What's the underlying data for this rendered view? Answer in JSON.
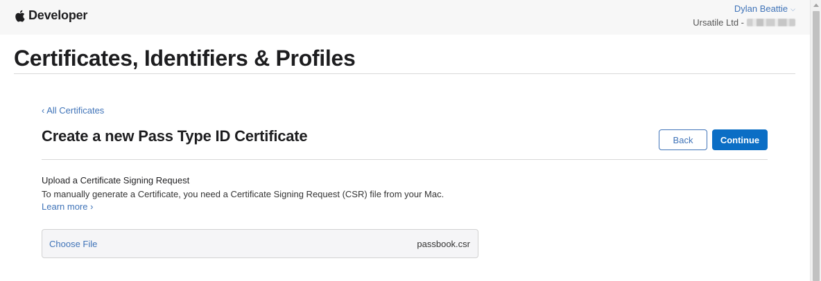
{
  "header": {
    "brand": "Developer",
    "user_name": "Dylan Beattie",
    "team_name": "Ursatile Ltd -",
    "chevron": "⌵"
  },
  "page": {
    "title": "Certificates, Identifiers & Profiles"
  },
  "content": {
    "back_link": "‹ All Certificates",
    "heading": "Create a new Pass Type ID Certificate",
    "back_button": "Back",
    "continue_button": "Continue",
    "upload_heading": "Upload a Certificate Signing Request",
    "upload_description": "To manually generate a Certificate, you need a Certificate Signing Request (CSR) file from your Mac.",
    "learn_more": "Learn more ›",
    "choose_file_label": "Choose File",
    "selected_file": "passbook.csr"
  },
  "icons": {
    "brand_logo": "apple-logo-icon",
    "user_menu": "chevron-down-icon"
  },
  "colors": {
    "link": "#3f73b8",
    "primary_button": "#0b6ec5"
  }
}
